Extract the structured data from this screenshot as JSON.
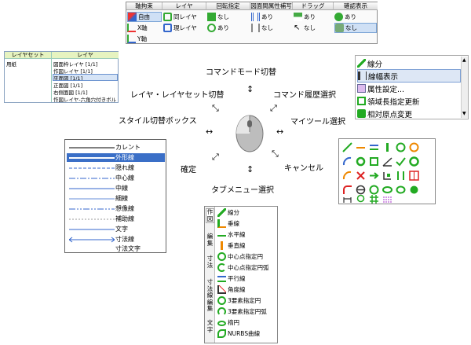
{
  "top_table": {
    "headers": [
      "軸拘束",
      "レイヤ",
      "回転指定",
      "図面間属性補写",
      "ドラッグ",
      "確認表示"
    ],
    "rows": [
      [
        "自由",
        "同レイヤ",
        "なし",
        "あり",
        "あり",
        "あり"
      ],
      [
        "X軸",
        "現レイヤ",
        "あり",
        "なし",
        "なし",
        "なし"
      ],
      [
        "Y軸",
        "",
        "",
        "",
        "",
        ""
      ]
    ]
  },
  "layerset": {
    "headers": [
      "レイヤセット",
      "レイヤ"
    ],
    "set_row": "用紙",
    "layers": [
      "図面枠レイヤ [1/1]",
      "作図レイヤ [1/1]",
      "平面図 [1/1]",
      "正面図 [1/1]",
      "右側面図 [1/1]",
      "作図レイヤ-六角穴付きボルト"
    ]
  },
  "center_labels": {
    "command_mode": "コマンドモード切替",
    "layer_switch": "レイヤ・レイヤセット切替",
    "command_history": "コマンド履歴選択",
    "style_box": "スタイル切替ボックス",
    "my_tools": "マイツール選択",
    "confirm": "確定",
    "cancel": "キャンセル",
    "tab_menu": "タブメニュー選択"
  },
  "history_list": [
    "線分",
    "線幅表示",
    "属性設定...",
    "領域長指定更新",
    "相対原点変更"
  ],
  "line_styles": [
    "カレント",
    "外形線",
    "隠れ線",
    "中心線",
    "中線",
    "細線",
    "想像線",
    "補助線",
    "文字",
    "寸法線",
    "寸法文字"
  ],
  "tab_menu": {
    "tabs": [
      "作図",
      "編集",
      "寸法",
      "寸法線編集",
      "文字"
    ],
    "items": [
      "線分",
      "垂線",
      "水平線",
      "垂直線",
      "中心点指定円",
      "中心点指定円弧",
      "平行線",
      "角度線",
      "3要素指定円",
      "3要素指定円弧",
      "楕円",
      "NURBS曲線"
    ]
  },
  "colors": {
    "selection": "#3a6fc7",
    "accent_green": "#2e9b3a",
    "accent_orange": "#e38a1a"
  }
}
